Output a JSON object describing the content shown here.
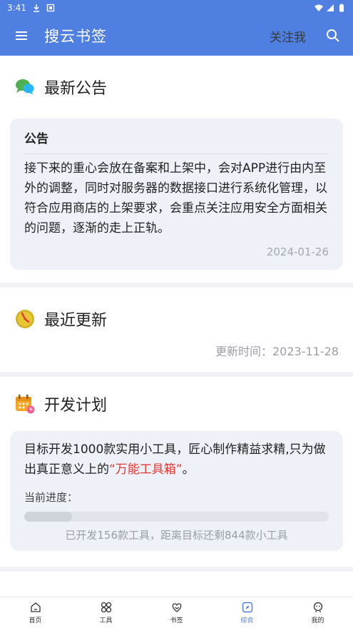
{
  "status_bar": {
    "time": "3:41"
  },
  "app_bar": {
    "title": "搜云书签",
    "follow_label": "关注我"
  },
  "announcement": {
    "section_title": "最新公告",
    "card_title": "公告",
    "body": "接下来的重心会放在备案和上架中，会对APP进行由内至外的调整，同时对服务器的数据接口进行系统化管理，以符合应用商店的上架要求，会重点关注应用安全方面相关的问题，逐渐的走上正轨。",
    "date": "2024-01-26"
  },
  "recent_update": {
    "section_title": "最近更新",
    "update_time": "更新时间：2023-11-28"
  },
  "dev_plan": {
    "section_title": "开发计划",
    "text_prefix": "目标开发1000款实用小工具，匠心制作精益求精,只为做出真正意义上的",
    "text_highlight": "“万能工具箱”",
    "text_suffix": "。",
    "progress_label": "当前进度：",
    "progress_fraction": 0.156,
    "progress_text": "已开发156款工具，距离目标还剩844款小工具"
  },
  "tabs": [
    {
      "label": "首页",
      "icon": "home-icon"
    },
    {
      "label": "工具",
      "icon": "tools-icon"
    },
    {
      "label": "书签",
      "icon": "bookmark-icon"
    },
    {
      "label": "综合",
      "icon": "compass-icon"
    },
    {
      "label": "我的",
      "icon": "profile-icon"
    }
  ],
  "colors": {
    "primary": "#4f7fe0",
    "highlight": "#e53935"
  }
}
